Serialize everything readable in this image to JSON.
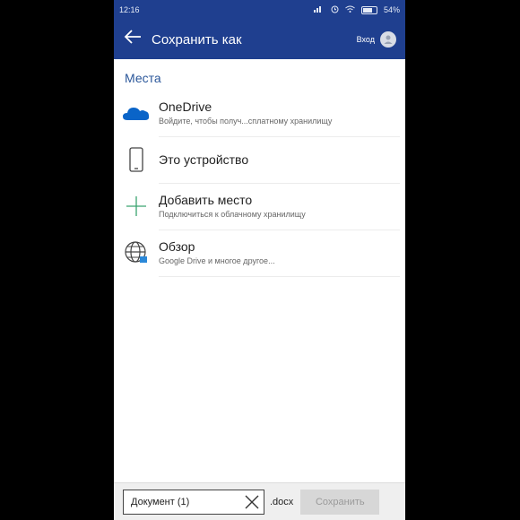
{
  "status_bar": {
    "time": "12:16",
    "battery": "54%",
    "icons": [
      "alarm-icon",
      "wifi-icon",
      "signal-icon",
      "battery-icon"
    ]
  },
  "app_bar": {
    "title": "Сохранить как",
    "signin_label": "Вход",
    "back_icon": "arrow-left-icon",
    "avatar_icon": "user-icon"
  },
  "places": {
    "section_label": "Места",
    "items": [
      {
        "icon": "cloud-icon",
        "primary": "OneDrive",
        "secondary": "Войдите, чтобы получ...сплатному хранилищу"
      },
      {
        "icon": "phone-icon",
        "primary": "Это устройство",
        "secondary": ""
      },
      {
        "icon": "plus-icon",
        "primary": "Добавить место",
        "secondary": "Подключиться к облачному хранилищу"
      },
      {
        "icon": "globe-icon",
        "primary": "Обзор",
        "secondary": "Google Drive и многое другое..."
      }
    ]
  },
  "bottom_bar": {
    "filename_value": "Документ (1)",
    "extension": ".docx",
    "save_label": "Сохранить"
  },
  "colors": {
    "accent": "#1f3f8f",
    "section_label": "#2b579a",
    "onedrive_blue": "#0a64c8"
  }
}
